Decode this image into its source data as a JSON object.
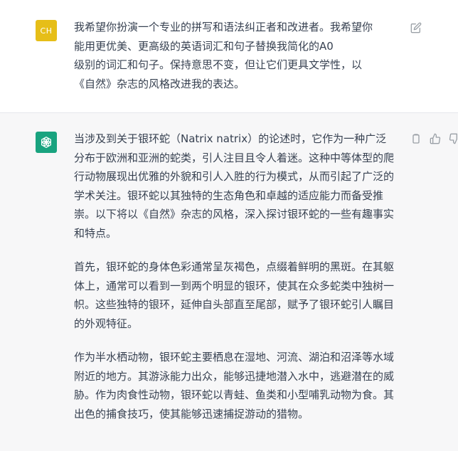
{
  "user_message": {
    "avatar_initials": "CH",
    "lines": [
      "我希望你扮演一个专业的拼写和语法纠正者和改进者。我希望你",
      "能用更优美、更高级的英语词汇和句子替换我简化的A0",
      "级别的词汇和句子。保持意思不变，但让它们更具文学性，以",
      "《自然》杂志的风格改进我的表达。"
    ],
    "edit_icon": "edit-icon"
  },
  "assistant_message": {
    "avatar_icon": "chatgpt-logo-icon",
    "paragraphs": [
      "当涉及到关于银环蛇（Natrix natrix）的论述时，它作为一种广泛分布于欧洲和亚洲的蛇类，引人注目且令人着迷。这种中等体型的爬行动物展现出优雅的外貌和引人入胜的行为模式，从而引起了广泛的学术关注。银环蛇以其独特的生态角色和卓越的适应能力而备受推崇。以下将以《自然》杂志的风格，深入探讨银环蛇的一些有趣事实和特点。",
      "首先，银环蛇的身体色彩通常呈灰褐色，点缀着鲜明的黑斑。在其躯体上，通常可以看到一到两个明显的银环，使其在众多蛇类中独树一帜。这些独特的银环，延伸自头部直至尾部，赋予了银环蛇引人瞩目的外观特征。",
      "作为半水栖动物，银环蛇主要栖息在湿地、河流、湖泊和沼泽等水域附近的地方。其游泳能力出众，能够迅捷地潜入水中，逃避潜在的威胁。作为肉食性动物，银环蛇以青蛙、鱼类和小型哺乳动物为食。其出色的捕食技巧，使其能够迅速捕捉游动的猎物。"
    ],
    "action_icons": [
      "copy-icon",
      "thumb-up-icon",
      "thumb-down-icon"
    ]
  },
  "colors": {
    "user_avatar_bg": "#e6be18",
    "bot_avatar_bg": "#19a37f",
    "assistant_bg": "#f7f7f8",
    "text": "#374151",
    "icon": "#9aa0a6"
  }
}
